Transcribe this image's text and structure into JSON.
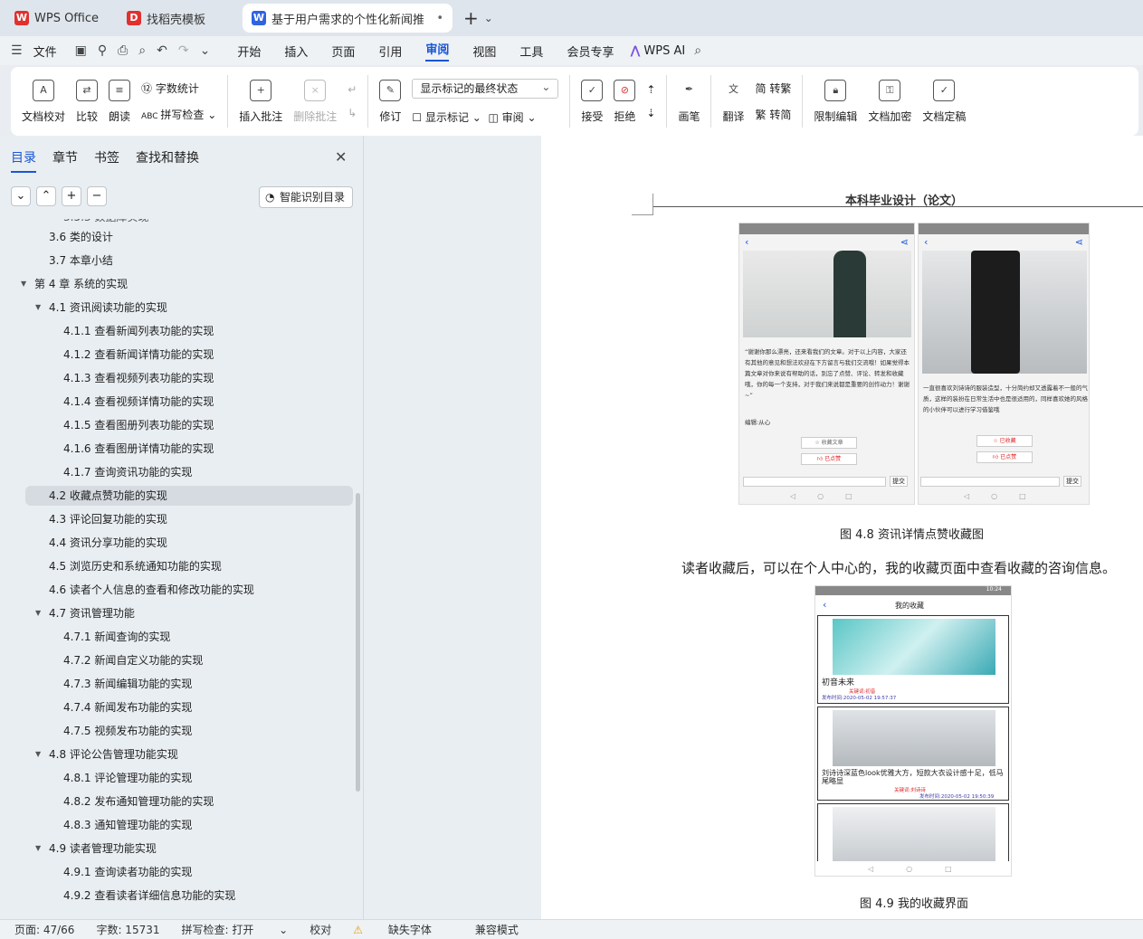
{
  "tabs": [
    {
      "label": "WPS Office",
      "icon": "wps-logo-icon",
      "color": "#e0312f"
    },
    {
      "label": "找稻壳模板",
      "icon": "docer-icon",
      "color": "#e0312f"
    },
    {
      "label": "基于用户需求的个性化新闻推",
      "icon": "word-doc-icon",
      "color": "#2f63e0"
    }
  ],
  "menu": {
    "file": "文件",
    "items": [
      "开始",
      "插入",
      "页面",
      "引用",
      "审阅",
      "视图",
      "工具",
      "会员专享"
    ],
    "selected": "审阅",
    "ai": "WPS AI"
  },
  "ribbon": {
    "doc_check": "文档校对",
    "compare": "比较",
    "read_aloud": "朗读",
    "word_count": "字数统计",
    "spell_check": "拼写检查",
    "insert_comment": "插入批注",
    "delete_comment": "删除批注",
    "revise": "修订",
    "markup_state": "显示标记的最终状态",
    "show_markup": "显示标记",
    "review": "审阅",
    "accept": "接受",
    "reject": "拒绝",
    "pen": "画笔",
    "translate": "翻译",
    "to_traditional": "转繁",
    "to_simplified": "转简",
    "restrict_edit": "限制编辑",
    "doc_encrypt": "文档加密",
    "doc_finalize": "文档定稿"
  },
  "sidebar": {
    "tabs": [
      "目录",
      "章节",
      "书签",
      "查找和替换"
    ],
    "smart_toc": "智能识别目录",
    "toc": [
      {
        "text": "3.6  类的设计",
        "level": 2
      },
      {
        "text": "3.7  本章小结",
        "level": 2
      },
      {
        "text": "第 4 章  系统的实现",
        "level": 1,
        "arrow": true
      },
      {
        "text": "4.1 资讯阅读功能的实现",
        "level": 2,
        "arrow": true
      },
      {
        "text": "4.1.1 查看新闻列表功能的实现",
        "level": 3
      },
      {
        "text": "4.1.2 查看新闻详情功能的实现",
        "level": 3
      },
      {
        "text": "4.1.3 查看视频列表功能的实现",
        "level": 3
      },
      {
        "text": "4.1.4 查看视频详情功能的实现",
        "level": 3
      },
      {
        "text": "4.1.5 查看图册列表功能的实现",
        "level": 3
      },
      {
        "text": "4.1.6 查看图册详情功能的实现",
        "level": 3
      },
      {
        "text": "4.1.7 查询资讯功能的实现",
        "level": 3
      },
      {
        "text": "4.2 收藏点赞功能的实现",
        "level": 2,
        "active": true
      },
      {
        "text": "4.3 评论回复功能的实现",
        "level": 2
      },
      {
        "text": "4.4 资讯分享功能的实现",
        "level": 2
      },
      {
        "text": "4.5 浏览历史和系统通知功能的实现",
        "level": 2
      },
      {
        "text": "4.6 读者个人信息的查看和修改功能的实现",
        "level": 2
      },
      {
        "text": "4.7 资讯管理功能",
        "level": 2,
        "arrow": true
      },
      {
        "text": "4.7.1 新闻查询的实现",
        "level": 3
      },
      {
        "text": "4.7.2 新闻自定义功能的实现",
        "level": 3
      },
      {
        "text": "4.7.3 新闻编辑功能的实现",
        "level": 3
      },
      {
        "text": "4.7.4 新闻发布功能的实现",
        "level": 3
      },
      {
        "text": "4.7.5 视频发布功能的实现",
        "level": 3
      },
      {
        "text": "4.8 评论公告管理功能实现",
        "level": 2,
        "arrow": true
      },
      {
        "text": "4.8.1 评论管理功能的实现",
        "level": 3
      },
      {
        "text": "4.8.2 发布通知管理功能的实现",
        "level": 3
      },
      {
        "text": "4.8.3 通知管理功能的实现",
        "level": 3
      },
      {
        "text": "4.9 读者管理功能实现",
        "level": 2,
        "arrow": true
      },
      {
        "text": "4.9.1 查询读者功能的实现",
        "level": 3
      },
      {
        "text": "4.9.2 查看读者详细信息功能的实现",
        "level": 3
      }
    ]
  },
  "document": {
    "header": "本科毕业设计（论文）",
    "phone1_text": "“谢谢你那么漂亮，还来看我们的文章。对于以上内容，大家还有其他的意见和想法欢迎在下方留言与我们交流哦！如果觉得本篇文章对你来说有帮助的话，别忘了点赞、评论、转发和收藏哦，你的每一个支持，对于我们来说都是重要的创作动力！谢谢~”",
    "phone1_editor": "编辑:从心",
    "phone1_collect": "收藏文章",
    "phone1_like": "已点赞",
    "phone2_text": "一直很喜欢刘诗诗的服装造型，十分简约却又透露着不一般的气质，这样的装扮在日常生活中也是很适用的，同样喜欢她的风格的小伙伴可以进行学习借鉴哦",
    "phone2_collect": "已收藏",
    "phone2_like": "已点赞",
    "submit": "提交",
    "fig48": "图 4.8  资讯详情点赞收藏图",
    "paragraph": "读者收藏后，可以在个人中心的，我的收藏页面中查看收藏的咨询信息。",
    "fav_title": "我的收藏",
    "fav_time_top": "10:24",
    "fav1_title": "初音未来",
    "fav1_kw": "关键词:初音",
    "fav1_date": "发布时间:2020-05-02 19:57:37",
    "fav2_title": "刘诗诗深蓝色look优雅大方，短款大衣设计感十足，低马尾略显",
    "fav2_kw": "关键词:刘诗诗",
    "fav2_date": "发布时间:2020-05-02 19:50:39",
    "fig49": "图 4.9 我的收藏界面"
  },
  "status": {
    "page": "页面: 47/66",
    "words": "字数: 15731",
    "spell": "拼写检查: 打开",
    "proof": "校对",
    "missing_font": "缺失字体",
    "compat": "兼容模式"
  }
}
